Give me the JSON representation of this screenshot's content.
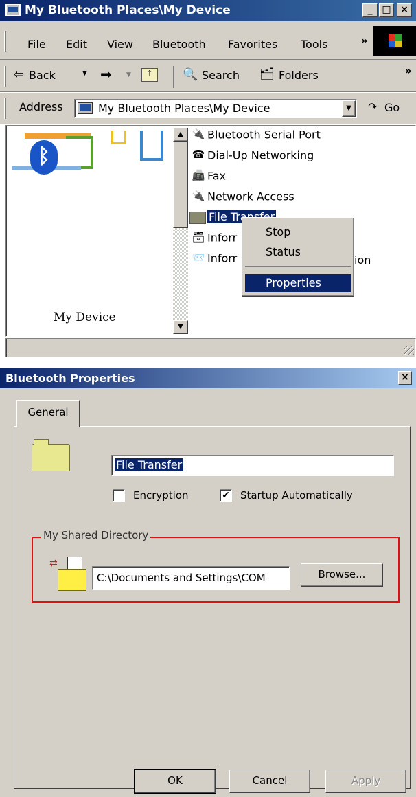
{
  "explorer": {
    "title": "My Bluetooth Places\\My Device",
    "window_buttons": {
      "minimize": "_",
      "maximize": "□",
      "close": "×"
    },
    "menu": [
      "File",
      "Edit",
      "View",
      "Bluetooth",
      "Favorites",
      "Tools"
    ],
    "menu_more": "»",
    "toolbar": {
      "back": "Back",
      "search": "Search",
      "folders": "Folders",
      "more": "»"
    },
    "address": {
      "label": "Address",
      "value": "My Bluetooth Places\\My Device",
      "go": "Go"
    },
    "left_panel": {
      "device_label": "My Device"
    },
    "items": [
      {
        "label": "Bluetooth Serial Port",
        "icon": "serial-port-icon"
      },
      {
        "label": "Dial-Up Networking",
        "icon": "dialup-icon"
      },
      {
        "label": "Fax",
        "icon": "fax-icon"
      },
      {
        "label": "Network Access",
        "icon": "network-access-icon"
      },
      {
        "label": "File Transfer",
        "icon": "folder-icon",
        "selected": true
      },
      {
        "label": "Inforr",
        "icon": "info-exchange-icon"
      },
      {
        "label": "Inforr",
        "icon": "info-sync-icon",
        "suffix": "ion"
      }
    ],
    "context_menu": [
      "Stop",
      "Status",
      "Properties"
    ]
  },
  "dialog": {
    "title": "Bluetooth Properties",
    "close": "×",
    "tab": "General",
    "service_name": "File Transfer",
    "encryption_label": "Encryption",
    "encryption_checked": false,
    "startup_label": "Startup Automatically",
    "startup_checked": true,
    "group_label": "My Shared Directory",
    "shared_path": "C:\\Documents and Settings\\COM",
    "browse": "Browse...",
    "ok": "OK",
    "cancel": "Cancel",
    "apply": "Apply"
  },
  "colors": {
    "titlebar": "#0a246a",
    "face": "#d4d0c8",
    "highlight_box": "#e01010"
  }
}
